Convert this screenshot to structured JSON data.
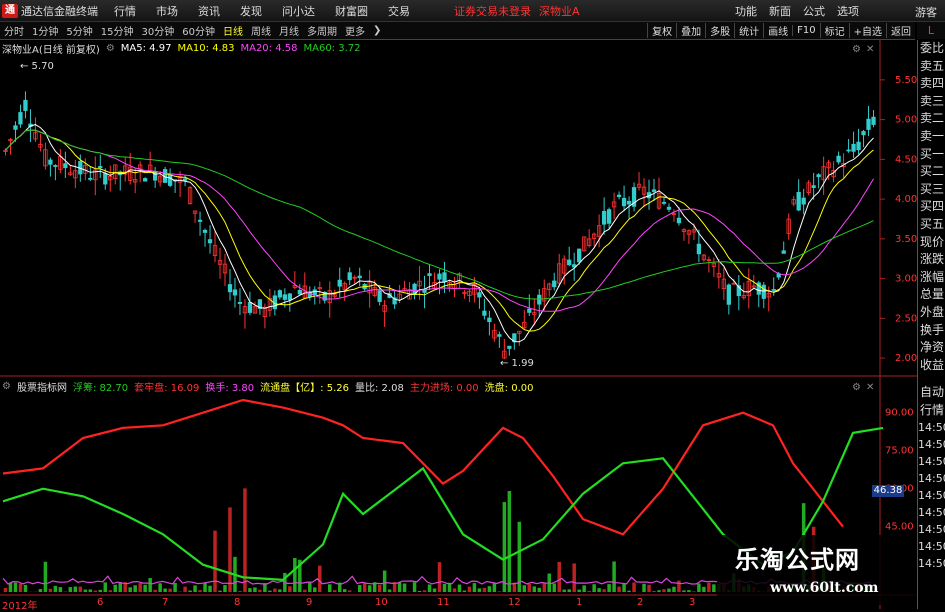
{
  "app": {
    "logo_mark": "通",
    "logo_text": "通达信金融终端",
    "menu": [
      "行情",
      "市场",
      "资讯",
      "发现",
      "问小达",
      "财富圈",
      "交易"
    ],
    "alert": "证券交易未登录",
    "alert_stock": "深物业A",
    "right_menu": [
      "功能",
      "新面",
      "公式",
      "选项"
    ],
    "guest": "游客"
  },
  "toolbar": {
    "items": [
      "分时",
      "1分钟",
      "5分钟",
      "15分钟",
      "30分钟",
      "60分钟",
      "日线",
      "周线",
      "月线",
      "多周期",
      "更多"
    ],
    "active": "日线",
    "right": [
      "复权",
      "叠加",
      "多股",
      "统计",
      "画线",
      "F10",
      "标记",
      "+自选",
      "返回"
    ]
  },
  "side": {
    "top": "L",
    "items": [
      "委比",
      "卖五",
      "卖四",
      "卖三",
      "卖二",
      "卖一",
      "买一",
      "买二",
      "买三",
      "买四",
      "买五",
      "现价",
      "涨跌",
      "涨幅",
      "总量",
      "外盘",
      "换手",
      "净资",
      "收益"
    ],
    "items2": [
      "自动",
      "行情"
    ],
    "times": [
      "14:50",
      "14:50",
      "14:50",
      "14:50",
      "14:50",
      "14:50",
      "14:50",
      "14:50",
      "14:50",
      "14:50"
    ]
  },
  "legend_main": {
    "stock": "深物业A(日线 前复权)",
    "ma5": "MA5: 4.97",
    "ma10": "MA10: 4.83",
    "ma20": "MA20: 4.58",
    "ma60": "MA60: 3.72",
    "colors": {
      "ma5": "#ffffff",
      "ma10": "#ffff00",
      "ma20": "#ff44ff",
      "ma60": "#22cc22"
    }
  },
  "legend_sub": {
    "name": "股票指标网",
    "items": [
      {
        "text": "浮筹: 82.70",
        "color": "#22cc22"
      },
      {
        "text": "套牢盘: 16.09",
        "color": "#ff3333"
      },
      {
        "text": "换手: 3.80",
        "color": "#ff44ff"
      },
      {
        "text": "流通盘【亿】: 5.26",
        "color": "#ffff33"
      },
      {
        "text": "量比: 2.08",
        "color": "#dddddd"
      },
      {
        "text": "主力进场: 0.00",
        "color": "#ff3333"
      },
      {
        "text": "洗盘: 0.00",
        "color": "#ffff33"
      }
    ]
  },
  "chart_data": [
    {
      "type": "candlestick",
      "title": "深物业A(日线 前复权)",
      "ylim": [
        1.85,
        5.75
      ],
      "yticks": [
        "5.50",
        "5.00",
        "4.50",
        "4.00",
        "3.50",
        "3.00",
        "2.50",
        "2.00"
      ],
      "annotations": [
        {
          "text": "5.70",
          "value": 5.7
        },
        {
          "text": "1.99",
          "value": 1.99
        }
      ],
      "series": [
        {
          "name": "MA5",
          "color": "#ffffff",
          "x": [
            0,
            0.05,
            0.1,
            0.15,
            0.2,
            0.25,
            0.3,
            0.35,
            0.4,
            0.45,
            0.5,
            0.55,
            0.6,
            0.65,
            0.7,
            0.75,
            0.8,
            0.85,
            0.9,
            0.95,
            1.0
          ],
          "values": [
            4.5,
            4.6,
            4.4,
            4.1,
            3.8,
            3.0,
            2.7,
            2.65,
            2.8,
            2.95,
            2.8,
            3.0,
            3.05,
            2.9,
            2.65,
            2.6,
            3.3,
            3.9,
            4.1,
            4.2,
            4.1
          ]
        },
        {
          "name": "MA60",
          "color": "#22cc22",
          "x": [
            0,
            0.1,
            0.2,
            0.3,
            0.4,
            0.5,
            0.6,
            0.7,
            0.8,
            0.9,
            1.0
          ],
          "values": [
            4.0,
            4.3,
            4.2,
            3.5,
            3.05,
            2.9,
            2.95,
            3.2,
            3.5,
            3.55,
            3.72
          ]
        }
      ]
    },
    {
      "type": "line",
      "ylim": [
        20,
        95
      ],
      "yticks": [
        "90.00",
        "75.00",
        "60.00",
        "45.00"
      ],
      "highlight_value": "46.38",
      "series": [
        {
          "name": "套牢盘",
          "color": "#ff2222"
        },
        {
          "name": "浮筹",
          "color": "#22dd22"
        },
        {
          "name": "换手",
          "color": "#dd44dd"
        }
      ]
    }
  ],
  "x_axis": [
    "2012年",
    "6",
    "7",
    "8",
    "9",
    "10",
    "11",
    "12",
    "1",
    "2",
    "3"
  ],
  "watermark": {
    "title": "乐淘公式网",
    "url": "www.60lt.com"
  }
}
